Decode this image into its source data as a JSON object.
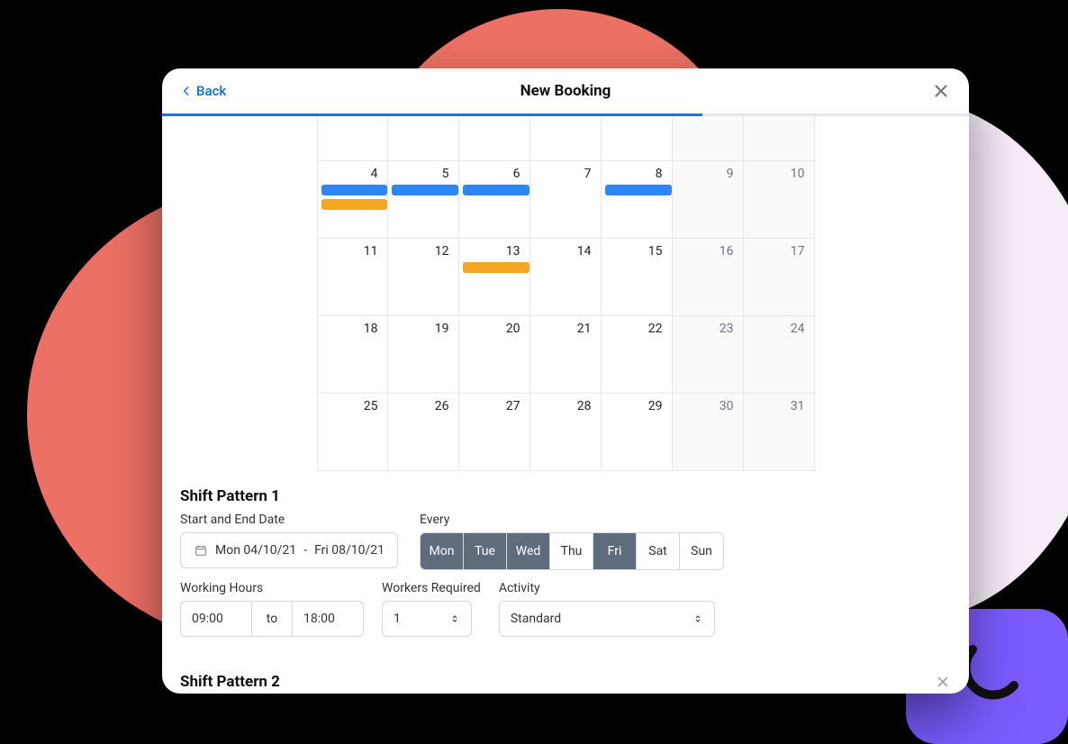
{
  "header": {
    "back_label": "Back",
    "title": "New Booking",
    "progress_percent": 67
  },
  "calendar": {
    "rows": [
      [
        "",
        "",
        "",
        "",
        "",
        "",
        ""
      ],
      [
        "4",
        "5",
        "6",
        "7",
        "8",
        "9",
        "10"
      ],
      [
        "11",
        "12",
        "13",
        "14",
        "15",
        "16",
        "17"
      ],
      [
        "18",
        "19",
        "20",
        "21",
        "22",
        "23",
        "24"
      ],
      [
        "25",
        "26",
        "27",
        "28",
        "29",
        "30",
        "31"
      ]
    ],
    "shaded_cols": [
      5,
      6
    ],
    "events": [
      {
        "row": 1,
        "col": 0,
        "type": "blue"
      },
      {
        "row": 1,
        "col": 1,
        "type": "blue"
      },
      {
        "row": 1,
        "col": 2,
        "type": "blue"
      },
      {
        "row": 1,
        "col": 4,
        "type": "blue"
      },
      {
        "row": 1,
        "col": 0,
        "type": "orange"
      },
      {
        "row": 2,
        "col": 2,
        "type": "orange-top"
      }
    ]
  },
  "shift1": {
    "title": "Shift Pattern 1",
    "date_label": "Start and End Date",
    "date_value_start": "Mon 04/10/21",
    "date_value_sep": "-",
    "date_value_end": "Fri 08/10/21",
    "every_label": "Every",
    "days": [
      {
        "label": "Mon",
        "on": true
      },
      {
        "label": "Tue",
        "on": true
      },
      {
        "label": "Wed",
        "on": true
      },
      {
        "label": "Thu",
        "on": false
      },
      {
        "label": "Fri",
        "on": true
      },
      {
        "label": "Sat",
        "on": false
      },
      {
        "label": "Sun",
        "on": false
      }
    ],
    "hours_label": "Working Hours",
    "hours_start": "09:00",
    "hours_to": "to",
    "hours_end": "18:00",
    "workers_label": "Workers Required",
    "workers_value": "1",
    "activity_label": "Activity",
    "activity_value": "Standard"
  },
  "shift2": {
    "title": "Shift Pattern 2"
  }
}
